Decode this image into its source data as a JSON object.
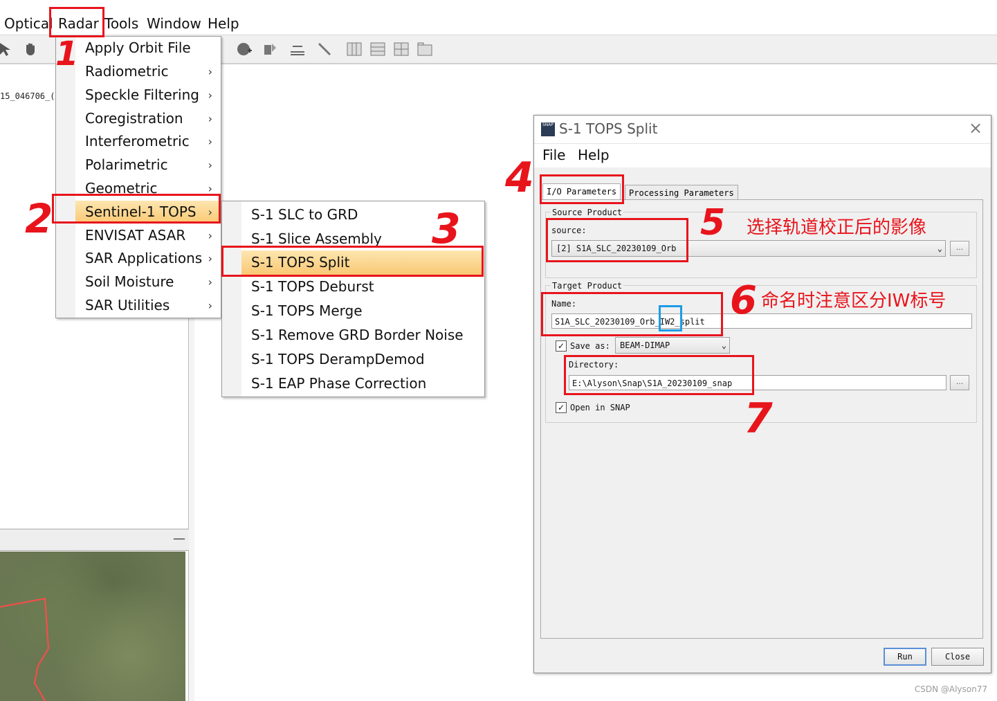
{
  "menubar": {
    "items": [
      "Optical",
      "Radar",
      "Tools",
      "Window",
      "Help"
    ]
  },
  "left": {
    "filename": "15_046706_(",
    "minimize": "—"
  },
  "radar_menu": {
    "items": [
      {
        "label": "Apply Orbit File",
        "arrow": ""
      },
      {
        "label": "Radiometric",
        "arrow": "›"
      },
      {
        "label": "Speckle Filtering",
        "arrow": "›"
      },
      {
        "label": "Coregistration",
        "arrow": "›"
      },
      {
        "label": "Interferometric",
        "arrow": "›"
      },
      {
        "label": "Polarimetric",
        "arrow": "›"
      },
      {
        "label": "Geometric",
        "arrow": "›"
      },
      {
        "label": "Sentinel-1 TOPS",
        "arrow": "›"
      },
      {
        "label": "ENVISAT ASAR",
        "arrow": "›"
      },
      {
        "label": "SAR Applications",
        "arrow": "›"
      },
      {
        "label": "Soil Moisture",
        "arrow": "›"
      },
      {
        "label": "SAR Utilities",
        "arrow": "›"
      }
    ],
    "selected_index": 7
  },
  "submenu": {
    "items": [
      "S-1 SLC to GRD",
      "S-1 Slice Assembly",
      "S-1 TOPS Split",
      "S-1 TOPS Deburst",
      "S-1 TOPS Merge",
      "S-1 Remove GRD Border Noise",
      "S-1 TOPS DerampDemod",
      "S-1 EAP Phase Correction"
    ],
    "selected_index": 2
  },
  "dialog": {
    "app_icon": "SNAP",
    "title": "S-1 TOPS Split",
    "close": "×",
    "menu": [
      "File",
      "Help"
    ],
    "tabs": [
      "I/O Parameters",
      "Processing Parameters"
    ],
    "source_group": "Source Product",
    "source_label": "source:",
    "source_value": "[2]  S1A_SLC_20230109_Orb",
    "target_group": "Target Product",
    "name_label": "Name:",
    "name_prefix": "S1A_SLC_20230109_Orb_",
    "name_highlight": "IW2",
    "name_suffix": "_split",
    "save_as_label": "Save as:",
    "save_as_checked": "✓",
    "save_format": "BEAM-DIMAP",
    "directory_label": "Directory:",
    "directory_value": "E:\\Alyson\\Snap\\S1A_20230109_snap",
    "open_in_snap_label": "Open in SNAP",
    "open_in_snap_checked": "✓",
    "browse": "...",
    "dropdown_arrow": "⌄",
    "run": "Run",
    "close_btn": "Close"
  },
  "annotations": {
    "n1": "1",
    "n2": "2",
    "n3": "3",
    "n4": "4",
    "n5": "5",
    "n6": "6",
    "n7": "7",
    "note5": "选择轨道校正后的影像",
    "note6": "命名时注意区分IW标号",
    "color": "#e8141c",
    "highlight_color": "#1d9be8"
  },
  "watermark": "CSDN @Alyson77"
}
